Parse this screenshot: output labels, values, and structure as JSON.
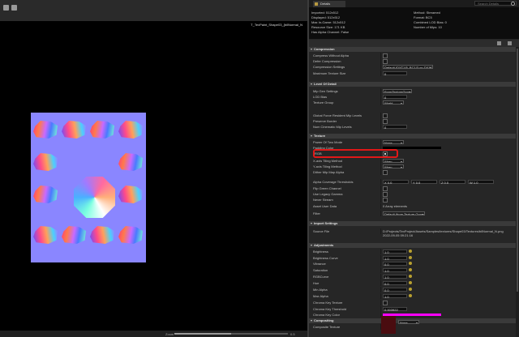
{
  "viewport": {
    "title": "T_TexPaint_Shape03_{bilNormal_N",
    "zoom_label": "Zoom",
    "zoom_value": "0.5"
  },
  "panel": {
    "tab_label": "Details",
    "search_placeholder": "Search Details"
  },
  "info": {
    "left": [
      "Imported: 512x512",
      "Displayed: 512x512",
      "Max In-Game: 512x512",
      "Resource Size: 171 KB",
      "Has Alpha Channel: False"
    ],
    "right": [
      "Method: Streamed",
      "Format: BC5",
      "Combined LOD Bias: 0",
      "Number of Mips: 10"
    ]
  },
  "sections": {
    "compression": "Compression",
    "lod": "Level Of Detail",
    "texture": "Texture",
    "import": "Import Settings",
    "adjustments": "Adjustments",
    "compositing": "Compositing"
  },
  "compression_rows": [
    {
      "label": "Compress Without Alpha"
    },
    {
      "label": "Defer Compression"
    },
    {
      "label": "Compression Settings",
      "value": "Default (DXT1/5, BC1/3 on DX11)"
    },
    {
      "label": "Maximum Texture Size",
      "value": "0"
    }
  ],
  "lod_rows": [
    {
      "label": "Mip Gen Settings",
      "value": "FromTextureGroup"
    },
    {
      "label": "LOD Bias",
      "value": "0"
    },
    {
      "label": "Texture Group",
      "value": "World"
    },
    {
      "label": "Global Force Resident Mip Levels"
    },
    {
      "label": "Preserve Border"
    },
    {
      "label": "Num Cinematic Mip Levels",
      "value": "0"
    }
  ],
  "texture_rows": [
    {
      "label": "Power Of Two Mode",
      "value": "None"
    },
    {
      "label": "Padding Color"
    },
    {
      "label": "sRGB"
    },
    {
      "label": "X-axis Tiling Method",
      "value": "Wrap"
    },
    {
      "label": "Y-axis Tiling Method",
      "value": "Wrap"
    },
    {
      "label": "Dither Mip Map Alpha"
    },
    {
      "label": "Alpha Coverage Thresholds",
      "x": "X 0.0",
      "y": "Y 0.0",
      "z": "Z 0.0",
      "w": "W 1.0"
    },
    {
      "label": "Flip Green Channel"
    },
    {
      "label": "Use Legacy Gamma"
    },
    {
      "label": "Never Stream"
    },
    {
      "label": "Asset User Data",
      "value": "0 Array elements"
    },
    {
      "label": "Filter",
      "value": "Default (from Texture Group)"
    }
  ],
  "import_rows": [
    {
      "label": "Source File",
      "value": "D:/Projects/TexProject/Assets/Samples/textures/Shape03/Textures/bilNormal_N.png",
      "date": "2022-09-05 09:21:16"
    }
  ],
  "adjust_rows": [
    {
      "label": "Brightness",
      "value": "1.0"
    },
    {
      "label": "Brightness Curve",
      "value": "1.0"
    },
    {
      "label": "Vibrance",
      "value": "0.0"
    },
    {
      "label": "Saturation",
      "value": "1.0"
    },
    {
      "label": "RGBCurve",
      "value": "1.0"
    },
    {
      "label": "Hue",
      "value": "0.0"
    },
    {
      "label": "Min Alpha",
      "value": "0.0"
    },
    {
      "label": "Max Alpha",
      "value": "1.0"
    },
    {
      "label": "Chroma Key Texture"
    },
    {
      "label": "Chroma Key Threshold",
      "value": "0.003922"
    },
    {
      "label": "Chroma Key Color"
    }
  ],
  "compositing_rows": [
    {
      "label": "Composite Texture",
      "value": "None"
    }
  ],
  "colors": {
    "padding_color": "#000000",
    "chroma_key_color": "#ff00ff",
    "highlight": "#e01818"
  }
}
